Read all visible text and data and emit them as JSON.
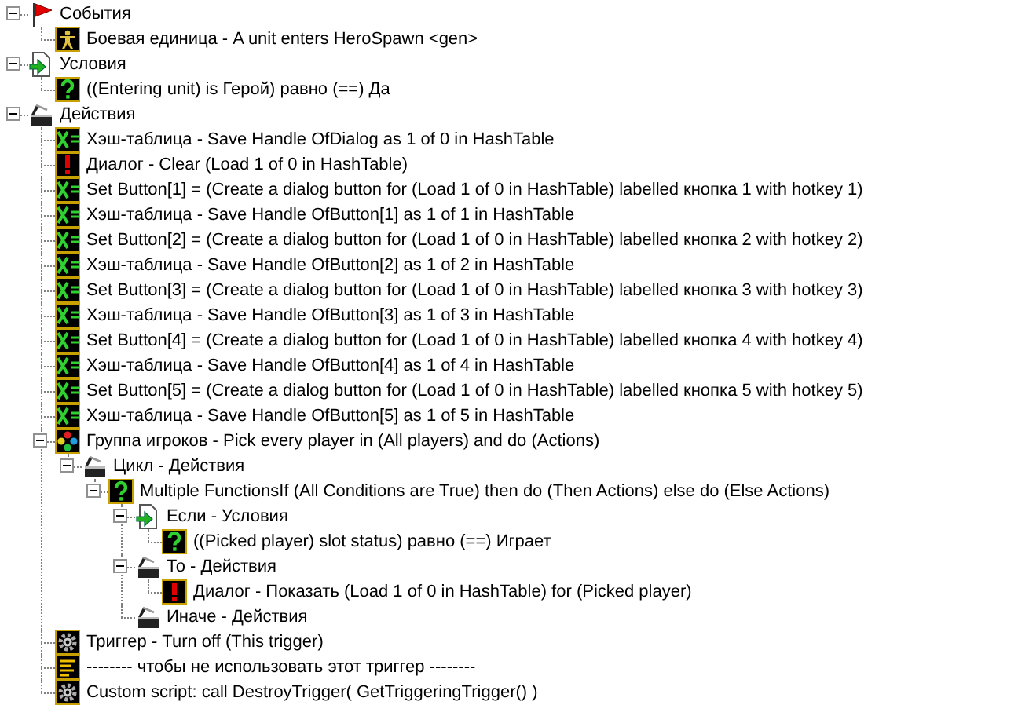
{
  "tree": [
    {
      "kind": "events",
      "label": "События",
      "expanded": true,
      "children": [
        {
          "kind": "unit",
          "label": "Боевая единица - A unit enters HeroSpawn <gen>"
        }
      ]
    },
    {
      "kind": "conditions",
      "label": "Условия",
      "expanded": true,
      "children": [
        {
          "kind": "question",
          "label": "((Entering unit) is Герой) равно (==) Да"
        }
      ]
    },
    {
      "kind": "actions",
      "label": "Действия",
      "expanded": true,
      "children": [
        {
          "kind": "set",
          "label": "Хэш-таблица - Save Handle OfDialog as 1 of 0 in HashTable"
        },
        {
          "kind": "alert",
          "label": "Диалог - Clear (Load 1 of 0 in HashTable)"
        },
        {
          "kind": "set",
          "label": "Set Button[1] = (Create a dialog button for (Load 1 of 0 in HashTable) labelled кнопка 1 with hotkey 1)"
        },
        {
          "kind": "set",
          "label": "Хэш-таблица - Save Handle OfButton[1] as 1 of 1 in HashTable"
        },
        {
          "kind": "set",
          "label": "Set Button[2] = (Create a dialog button for (Load 1 of 0 in HashTable) labelled кнопка 2 with hotkey 2)"
        },
        {
          "kind": "set",
          "label": "Хэш-таблица - Save Handle OfButton[2] as 1 of 2 in HashTable"
        },
        {
          "kind": "set",
          "label": "Set Button[3] = (Create a dialog button for (Load 1 of 0 in HashTable) labelled кнопка 3 with hotkey 3)"
        },
        {
          "kind": "set",
          "label": "Хэш-таблица - Save Handle OfButton[3] as 1 of 3 in HashTable"
        },
        {
          "kind": "set",
          "label": "Set Button[4] = (Create a dialog button for (Load 1 of 0 in HashTable) labelled кнопка 4 with hotkey 4)"
        },
        {
          "kind": "set",
          "label": "Хэш-таблица - Save Handle OfButton[4] as 1 of 4 in HashTable"
        },
        {
          "kind": "set",
          "label": "Set Button[5] = (Create a dialog button for (Load 1 of 0 in HashTable) labelled кнопка 5 with hotkey 5)"
        },
        {
          "kind": "set",
          "label": "Хэш-таблица - Save Handle OfButton[5] as 1 of 5 in HashTable"
        },
        {
          "kind": "group",
          "label": "Группа игроков - Pick every player in (All players) and do (Actions)",
          "expanded": true,
          "children": [
            {
              "kind": "actions",
              "label": "Цикл - Действия",
              "expanded": true,
              "children": [
                {
                  "kind": "question",
                  "label": "Multiple FunctionsIf (All Conditions are True) then do (Then Actions) else do (Else Actions)",
                  "expanded": true,
                  "children": [
                    {
                      "kind": "conditions",
                      "label": "Если - Условия",
                      "expanded": true,
                      "children": [
                        {
                          "kind": "question",
                          "label": "((Picked player) slot status) равно (==) Играет"
                        }
                      ]
                    },
                    {
                      "kind": "actions",
                      "label": "То - Действия",
                      "expanded": true,
                      "children": [
                        {
                          "kind": "alert",
                          "label": "Диалог - Показать (Load 1 of 0 in HashTable) for (Picked player)"
                        }
                      ]
                    },
                    {
                      "kind": "actions",
                      "label": "Иначе - Действия"
                    }
                  ]
                }
              ]
            }
          ]
        },
        {
          "kind": "gear",
          "label": "Триггер - Turn off (This trigger)"
        },
        {
          "kind": "comment",
          "label": "-------- чтобы не использовать этот триггер --------"
        },
        {
          "kind": "gear",
          "label": "Custom script:   call DestroyTrigger( GetTriggeringTrigger() )"
        }
      ]
    }
  ]
}
